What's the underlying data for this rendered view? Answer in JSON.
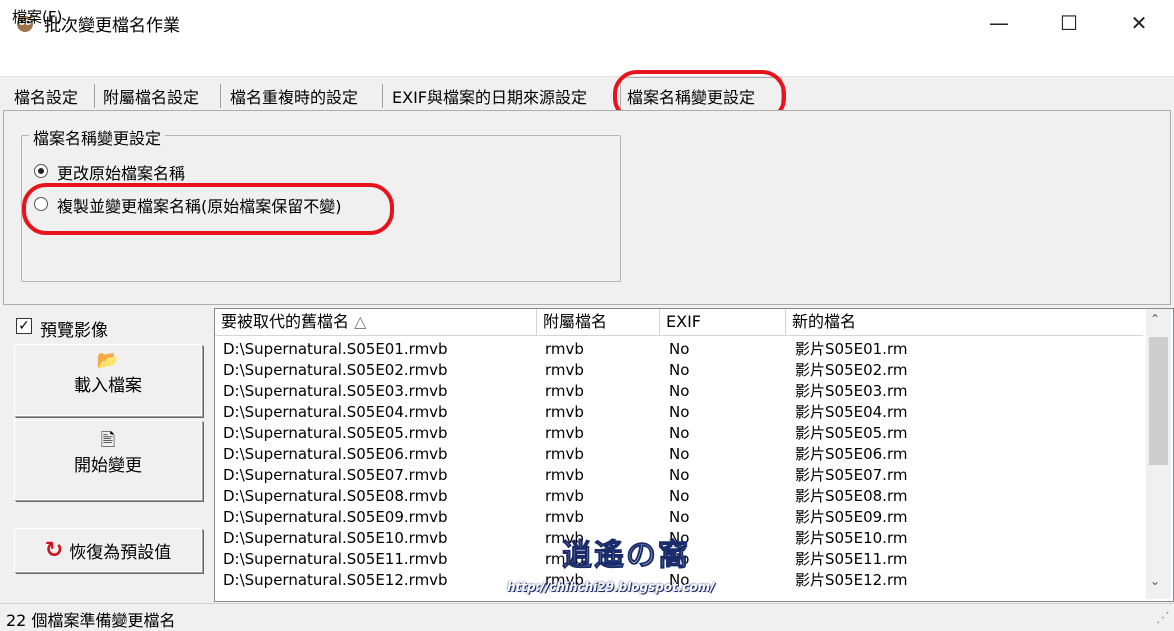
{
  "window": {
    "title": "批次變更檔名作業",
    "minimize": "—",
    "maximize": "☐",
    "close": "✕"
  },
  "menu": {
    "file": "檔案(F)"
  },
  "tabs": [
    {
      "label": "檔名設定"
    },
    {
      "label": "附屬檔名設定"
    },
    {
      "label": "檔名重複時的設定"
    },
    {
      "label": "EXIF與檔案的日期來源設定"
    },
    {
      "label": "檔案名稱變更設定",
      "active": true
    }
  ],
  "rename_group": {
    "title": "檔案名稱變更設定",
    "options": [
      {
        "label": "更改原始檔案名稱",
        "selected": true
      },
      {
        "label": "複製並變更檔案名稱(原始檔案保留不變)",
        "selected": false
      }
    ]
  },
  "preview": {
    "label": "預覽影像",
    "checked": true,
    "check_glyph": "✓"
  },
  "buttons": {
    "load": {
      "label": "載入檔案",
      "icon": "folder-open-icon"
    },
    "start": {
      "label": "開始變更",
      "icon": "rename-icon"
    },
    "reset": {
      "label": "恢復為預設值",
      "icon": "refresh-icon"
    }
  },
  "list": {
    "columns": [
      "要被取代的舊檔名",
      "附屬檔名",
      "EXIF",
      "新的檔名"
    ],
    "sort_indicator": "△",
    "rows": [
      [
        "D:\\Supernatural.S05E01.rmvb",
        "rmvb",
        "No",
        "影片S05E01.rm"
      ],
      [
        "D:\\Supernatural.S05E02.rmvb",
        "rmvb",
        "No",
        "影片S05E02.rm"
      ],
      [
        "D:\\Supernatural.S05E03.rmvb",
        "rmvb",
        "No",
        "影片S05E03.rm"
      ],
      [
        "D:\\Supernatural.S05E04.rmvb",
        "rmvb",
        "No",
        "影片S05E04.rm"
      ],
      [
        "D:\\Supernatural.S05E05.rmvb",
        "rmvb",
        "No",
        "影片S05E05.rm"
      ],
      [
        "D:\\Supernatural.S05E06.rmvb",
        "rmvb",
        "No",
        "影片S05E06.rm"
      ],
      [
        "D:\\Supernatural.S05E07.rmvb",
        "rmvb",
        "No",
        "影片S05E07.rm"
      ],
      [
        "D:\\Supernatural.S05E08.rmvb",
        "rmvb",
        "No",
        "影片S05E08.rm"
      ],
      [
        "D:\\Supernatural.S05E09.rmvb",
        "rmvb",
        "No",
        "影片S05E09.rm"
      ],
      [
        "D:\\Supernatural.S05E10.rmvb",
        "rmvb",
        "No",
        "影片S05E10.rm"
      ],
      [
        "D:\\Supernatural.S05E11.rmvb",
        "rmvb",
        "No",
        "影片S05E11.rm"
      ],
      [
        "D:\\Supernatural.S05E12.rmvb",
        "rmvb",
        "No",
        "影片S05E12.rm"
      ]
    ]
  },
  "watermark": {
    "signature": "逍遙の窩",
    "url": "http://chihchi29.blogspot.com/"
  },
  "status": {
    "text": "22 個檔案準備變更檔名"
  },
  "colors": {
    "highlight": "#e8141d",
    "selection": "#cce8ff"
  }
}
